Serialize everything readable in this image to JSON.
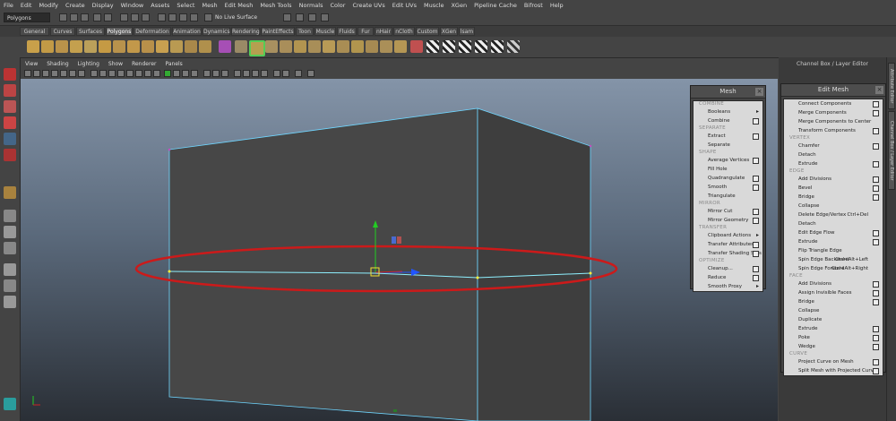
{
  "menubar": [
    "File",
    "Edit",
    "Modify",
    "Create",
    "Display",
    "Window",
    "Assets",
    "Select",
    "Mesh",
    "Edit Mesh",
    "Mesh Tools",
    "Normals",
    "Color",
    "Create UVs",
    "Edit UVs",
    "Muscle",
    "XGen",
    "Pipeline Cache",
    "Bifrost",
    "Help"
  ],
  "status": {
    "mode": "Polygons",
    "live_surface": "No Live Surface"
  },
  "shelf_tabs": [
    "General",
    "Curves",
    "Surfaces",
    "Polygons",
    "Deformation",
    "Animation",
    "Dynamics",
    "Rendering",
    "PaintEffects",
    "Toon",
    "Muscle",
    "Fluids",
    "Fur",
    "nHair",
    "nCloth",
    "Custom",
    "XGen",
    "lsam"
  ],
  "active_shelf_tab": "Polygons",
  "viewport_menu": [
    "View",
    "Shading",
    "Lighting",
    "Show",
    "Renderer",
    "Panels"
  ],
  "channel_box": {
    "title": "Channel Box / Layer Editor"
  },
  "side_tabs": [
    "Attribute Editor",
    "Channel Box / Layer Editor"
  ],
  "mesh_menu": {
    "title": "Mesh",
    "sections": [
      {
        "name": "COMBINE",
        "items": [
          {
            "label": "Booleans",
            "arrow": true
          },
          {
            "label": "Combine",
            "box": true
          }
        ]
      },
      {
        "name": "SEPARATE",
        "items": [
          {
            "label": "Extract",
            "box": true
          },
          {
            "label": "Separate"
          }
        ]
      },
      {
        "name": "SHAPE",
        "items": [
          {
            "label": "Average Vertices",
            "box": true
          },
          {
            "label": "Fill Hole"
          },
          {
            "label": "Quadrangulate",
            "box": true
          },
          {
            "label": "Smooth",
            "box": true
          },
          {
            "label": "Triangulate"
          }
        ]
      },
      {
        "name": "MIRROR",
        "items": [
          {
            "label": "Mirror Cut",
            "box": true
          },
          {
            "label": "Mirror Geometry",
            "box": true
          }
        ]
      },
      {
        "name": "TRANSFER",
        "items": [
          {
            "label": "Clipboard Actions",
            "arrow": true
          },
          {
            "label": "Transfer Attributes",
            "box": true
          },
          {
            "label": "Transfer Shading Sets",
            "box": true
          }
        ]
      },
      {
        "name": "OPTIMIZE",
        "items": [
          {
            "label": "Cleanup...",
            "box": true
          },
          {
            "label": "Reduce",
            "box": true
          },
          {
            "label": "Smooth Proxy",
            "arrow": true
          }
        ]
      }
    ]
  },
  "edit_mesh_menu": {
    "title": "Edit Mesh",
    "sections": [
      {
        "name": "",
        "items": [
          {
            "label": "Connect Components",
            "box": true
          },
          {
            "label": "Merge Components",
            "box": true
          },
          {
            "label": "Merge Components to Center"
          },
          {
            "label": "Transform Components",
            "box": true
          }
        ]
      },
      {
        "name": "VERTEX",
        "items": [
          {
            "label": "Chamfer",
            "box": true
          },
          {
            "label": "Detach"
          },
          {
            "label": "Extrude",
            "box": true
          }
        ]
      },
      {
        "name": "EDGE",
        "items": [
          {
            "label": "Add Divisions",
            "box": true
          },
          {
            "label": "Bevel",
            "box": true
          },
          {
            "label": "Bridge",
            "box": true
          },
          {
            "label": "Collapse"
          },
          {
            "label": "Delete Edge/Vertex",
            "shortcut": "Ctrl+Del"
          },
          {
            "label": "Detach"
          },
          {
            "label": "Edit Edge Flow",
            "box": true
          },
          {
            "label": "Extrude",
            "box": true
          },
          {
            "label": "Flip Triangle Edge"
          },
          {
            "label": "Spin Edge Backward",
            "shortcut": "Ctrl+Alt+Left"
          },
          {
            "label": "Spin Edge Forward",
            "shortcut": "Ctrl+Alt+Right"
          }
        ]
      },
      {
        "name": "FACE",
        "items": [
          {
            "label": "Add Divisions",
            "box": true
          },
          {
            "label": "Assign Invisible Faces",
            "box": true
          },
          {
            "label": "Bridge",
            "box": true
          },
          {
            "label": "Collapse"
          },
          {
            "label": "Duplicate"
          },
          {
            "label": "Extrude",
            "box": true
          },
          {
            "label": "Poke",
            "box": true
          },
          {
            "label": "Wedge",
            "box": true
          }
        ]
      },
      {
        "name": "CURVE",
        "items": [
          {
            "label": "Project Curve on Mesh",
            "box": true
          },
          {
            "label": "Split Mesh with Projected Curve",
            "box": true
          }
        ]
      }
    ]
  },
  "colors": {
    "highlight_ellipse": "#cc1a1a",
    "edge_select": "#6fe0ff",
    "manip_y": "#22cc22",
    "manip_x": "#cc2222",
    "manip_z": "#2255ff"
  }
}
